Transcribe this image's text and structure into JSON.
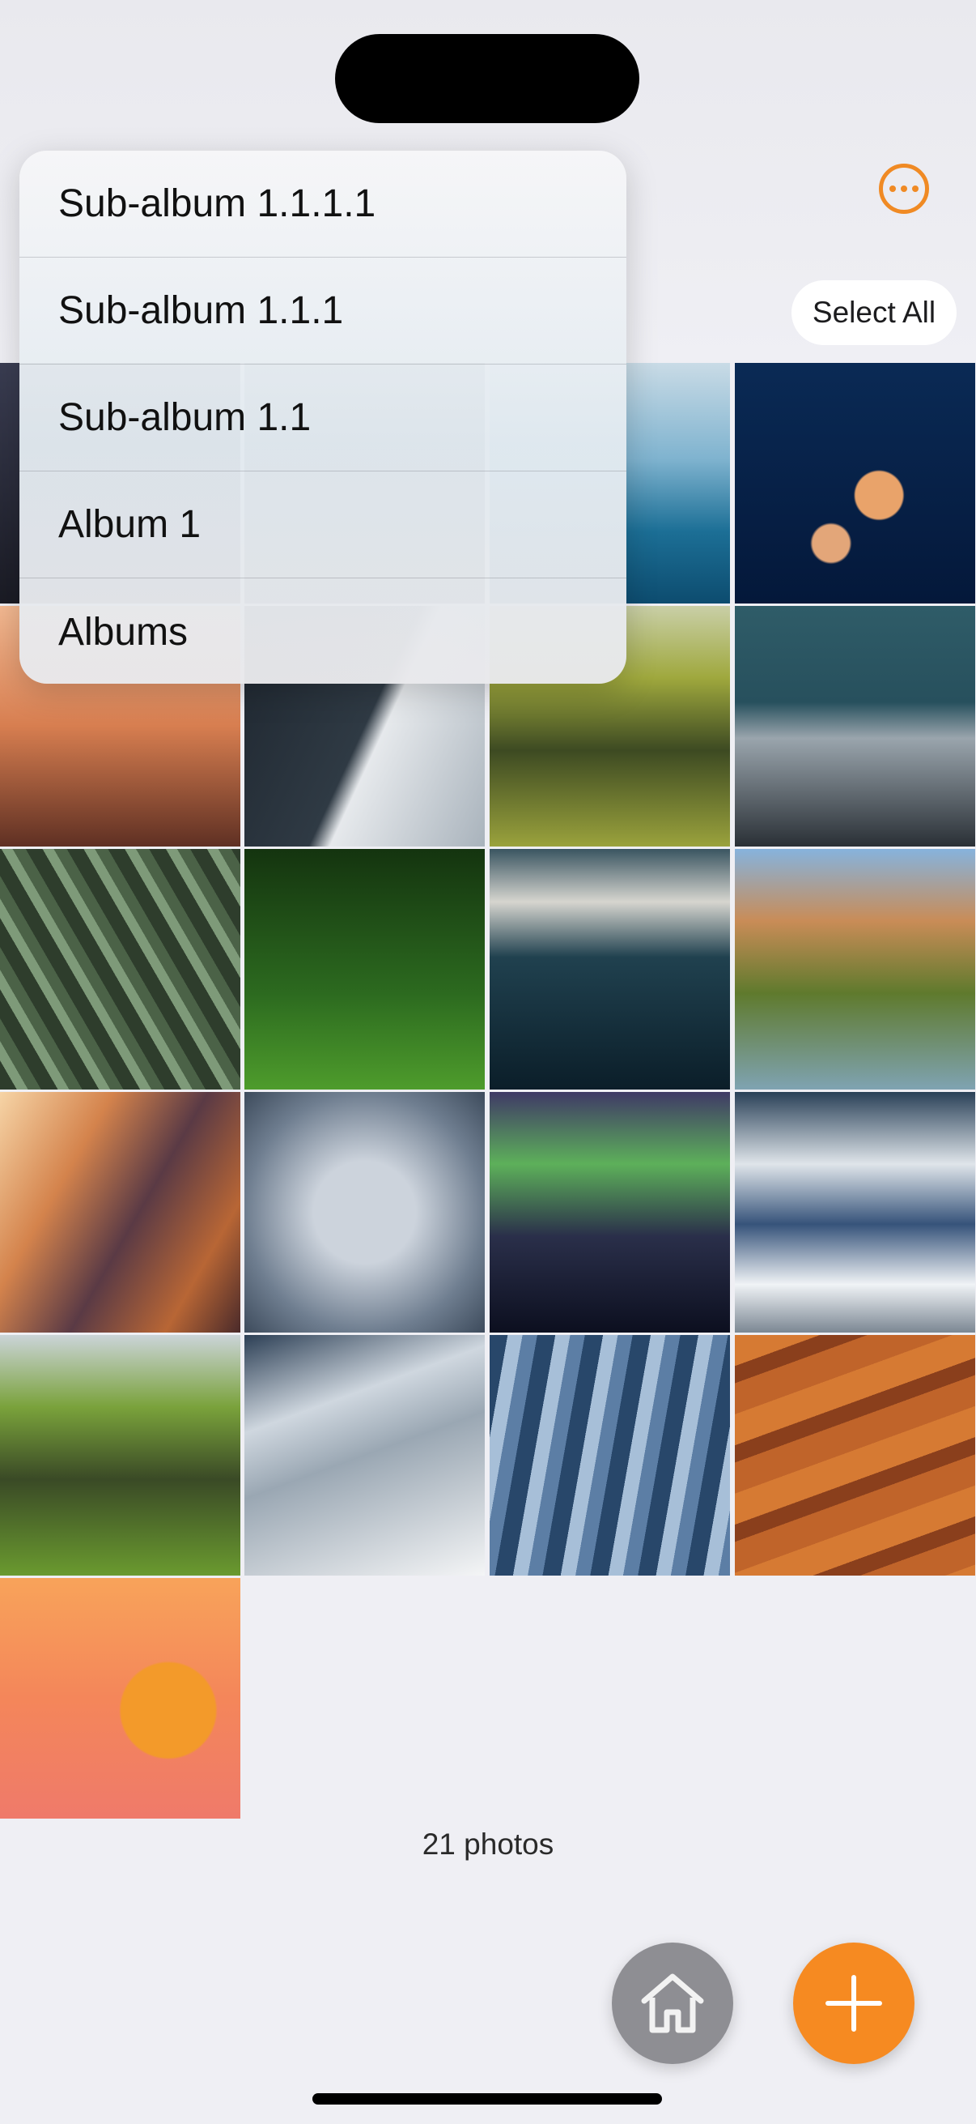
{
  "menu": {
    "items": [
      {
        "label": "Sub-album 1.1.1.1"
      },
      {
        "label": "Sub-album 1.1.1"
      },
      {
        "label": "Sub-album 1.1"
      },
      {
        "label": "Album 1"
      },
      {
        "label": "Albums"
      }
    ]
  },
  "toolbar": {
    "select_all_label": "Select All",
    "more_icon": "ellipsis-circle-icon"
  },
  "photos": {
    "count_label": "21 photos",
    "items": [
      {
        "name": "mountain-night"
      },
      {
        "name": "coastal-wave"
      },
      {
        "name": "river-valley"
      },
      {
        "name": "ocean-surfer"
      },
      {
        "name": "blue-jellyfish"
      },
      {
        "name": "misty-forest"
      },
      {
        "name": "sand-dune"
      },
      {
        "name": "green-delta"
      },
      {
        "name": "snowy-peaks"
      },
      {
        "name": "wind-grass"
      },
      {
        "name": "green-forest"
      },
      {
        "name": "foggy-ocean"
      },
      {
        "name": "canyon-river"
      },
      {
        "name": "antelope-canyon"
      },
      {
        "name": "snowy-trees"
      },
      {
        "name": "aurora-lake"
      },
      {
        "name": "aurora-snow"
      },
      {
        "name": "waterfall-cliff"
      },
      {
        "name": "cloud-ridge"
      },
      {
        "name": "ice-ridges"
      },
      {
        "name": "desert-dunes"
      },
      {
        "name": "orange-jellyfish"
      }
    ]
  },
  "floating": {
    "home_icon": "house-icon",
    "add_icon": "plus-icon"
  },
  "colors": {
    "accent": "#f68a21",
    "background": "#efeff4"
  }
}
